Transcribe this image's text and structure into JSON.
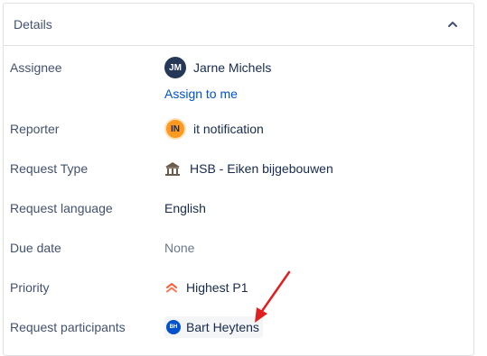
{
  "details": {
    "title": "Details",
    "collapse_icon": "chevron-up-icon"
  },
  "fields": {
    "assignee": {
      "label": "Assignee",
      "avatar_initials": "JM",
      "name": "Jarne Michels",
      "assign_link": "Assign to me"
    },
    "reporter": {
      "label": "Reporter",
      "avatar_initials": "IN",
      "name": "it notification"
    },
    "request_type": {
      "label": "Request Type",
      "icon": "building-icon",
      "value": "HSB - Eiken bijgebouwen"
    },
    "request_language": {
      "label": "Request language",
      "value": "English"
    },
    "due_date": {
      "label": "Due date",
      "value": "None"
    },
    "priority": {
      "label": "Priority",
      "icon": "priority-highest-icon",
      "value": "Highest P1",
      "color": "#de350b"
    },
    "request_participants": {
      "label": "Request participants",
      "avatar_initials": "BH",
      "name": "Bart Heytens"
    }
  },
  "annotation": {
    "type": "arrow",
    "color": "#e02020"
  }
}
